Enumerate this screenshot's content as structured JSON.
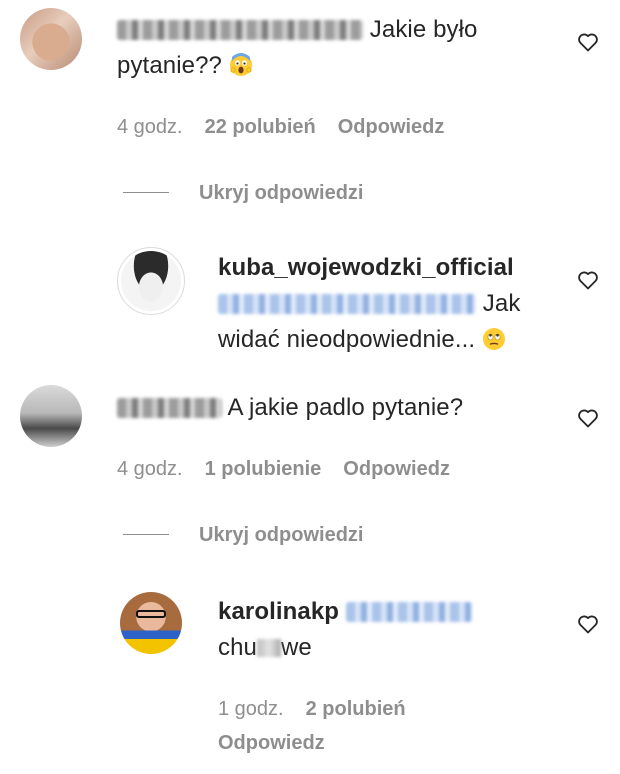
{
  "comments": [
    {
      "username_blurred": true,
      "text_line1": "Jakie było",
      "text_line2": "pytanie??",
      "emoji": "face-screaming-in-fear",
      "time": "4 godz.",
      "likes": "22 polubień",
      "reply": "Odpowiedz",
      "hide_replies": "Ukryj odpowiedzi",
      "replies": [
        {
          "username": "kuba_wojewodzki_official",
          "mention_blurred": true,
          "text_line1": "Jak",
          "text_line2": "widać nieodpowiednie...",
          "emoji": "face-with-rolling-eyes"
        }
      ]
    },
    {
      "username_blurred": true,
      "text": "A jakie padlo pytanie?",
      "time": "4 godz.",
      "likes": "1 polubienie",
      "reply": "Odpowiedz",
      "hide_replies": "Ukryj odpowiedzi",
      "replies": [
        {
          "username": "karolinakp",
          "mention_blurred": true,
          "text_start": "chu",
          "text_end": "we",
          "time": "1 godz.",
          "likes": "2 polubień",
          "reply": "Odpowiedz"
        }
      ]
    }
  ],
  "icons": {
    "like": "heart-outline-icon"
  },
  "colors": {
    "text": "#262626",
    "secondary": "#8e8e8e",
    "mention": "#00376b"
  }
}
